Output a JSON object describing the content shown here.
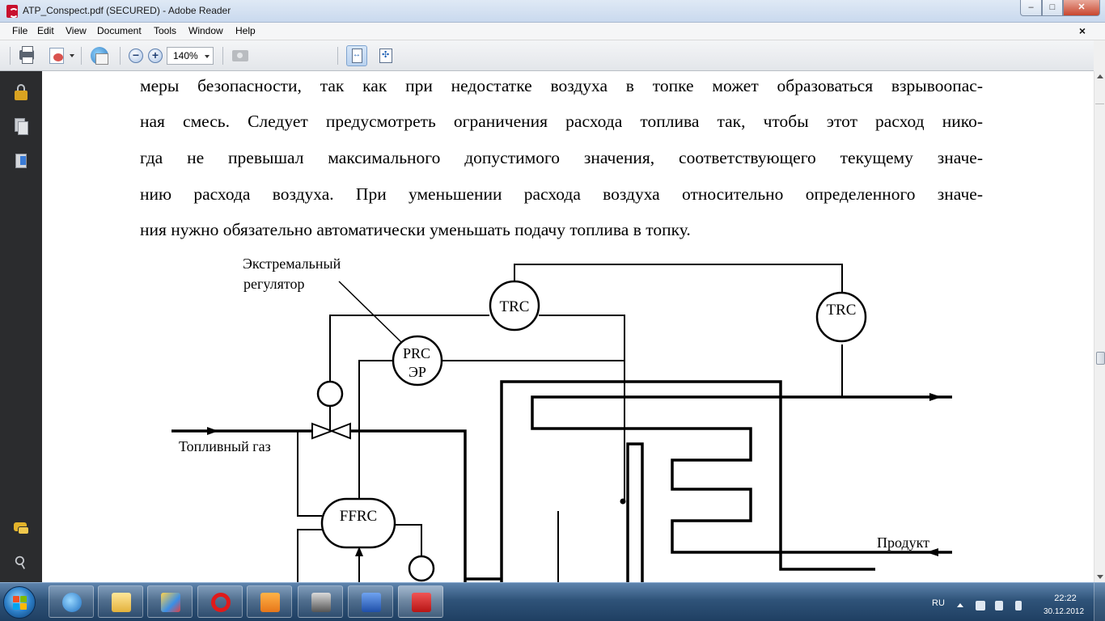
{
  "window": {
    "title": "ATP_Conspect.pdf (SECURED) - Adobe Reader",
    "controls": {
      "minimize": "–",
      "maximize": "□",
      "close": "✕"
    }
  },
  "menu": {
    "items": [
      "File",
      "Edit",
      "View",
      "Document",
      "Tools",
      "Window",
      "Help"
    ],
    "close_doc": "×"
  },
  "toolbar": {
    "zoom_value": "140%"
  },
  "document": {
    "lines": [
      "меры безопасности, так как при недостатке воздуха в топке может образоваться взрывоопас-",
      "ная смесь. Следует предусмотреть ограничения расхода топлива так, чтобы этот расход нико-",
      "гда не превышал максимального допустимого значения, соответствующего текущему значе-",
      "нию расхода воздуха. При уменьшении расхода воздуха относительно определенного значе-",
      "ния нужно обязательно автоматически уменьшать подачу топлива в топку."
    ],
    "diagram": {
      "label_extremal_1": "Экстремальный",
      "label_extremal_2": "регулятор",
      "label_fuel_gas": "Топливный газ",
      "label_product": "Продукт",
      "trc_top": "TRC",
      "trc_right": "TRC",
      "prc_1": "PRC",
      "prc_2": "ЭР",
      "ffrc": "FFRC"
    }
  },
  "taskbar": {
    "language": "RU",
    "time": "22:22",
    "date": "30.12.2012",
    "apps": [
      "internet-explorer",
      "windows-explorer",
      "paint",
      "opera",
      "media-player",
      "scanner",
      "word",
      "adobe-reader"
    ]
  }
}
